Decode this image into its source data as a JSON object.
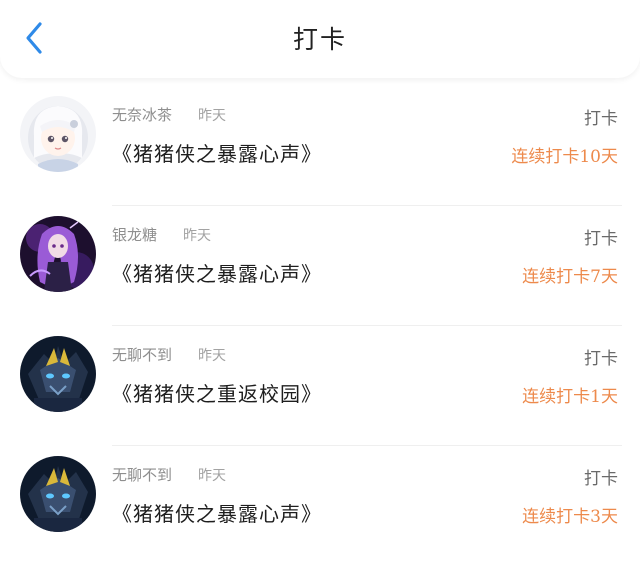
{
  "header": {
    "title": "打卡",
    "back_icon": "chevron-left-icon",
    "accent": "#2f8ae8"
  },
  "colors": {
    "streak": "#ed8a4c"
  },
  "entries": [
    {
      "user": "无奈冰茶",
      "time": "昨天",
      "book": "《猪猪侠之暴露心声》",
      "action": "打卡",
      "streak": "连续打卡10天",
      "avatar": "anime-girl-white-hair"
    },
    {
      "user": "银龙糖",
      "time": "昨天",
      "book": "《猪猪侠之暴露心声》",
      "action": "打卡",
      "streak": "连续打卡7天",
      "avatar": "anime-girl-purple-hair"
    },
    {
      "user": "无聊不到",
      "time": "昨天",
      "book": "《猪猪侠之重返校园》",
      "action": "打卡",
      "streak": "连续打卡1天",
      "avatar": "armored-dragon-robot"
    },
    {
      "user": "无聊不到",
      "time": "昨天",
      "book": "《猪猪侠之暴露心声》",
      "action": "打卡",
      "streak": "连续打卡3天",
      "avatar": "armored-dragon-robot"
    }
  ]
}
